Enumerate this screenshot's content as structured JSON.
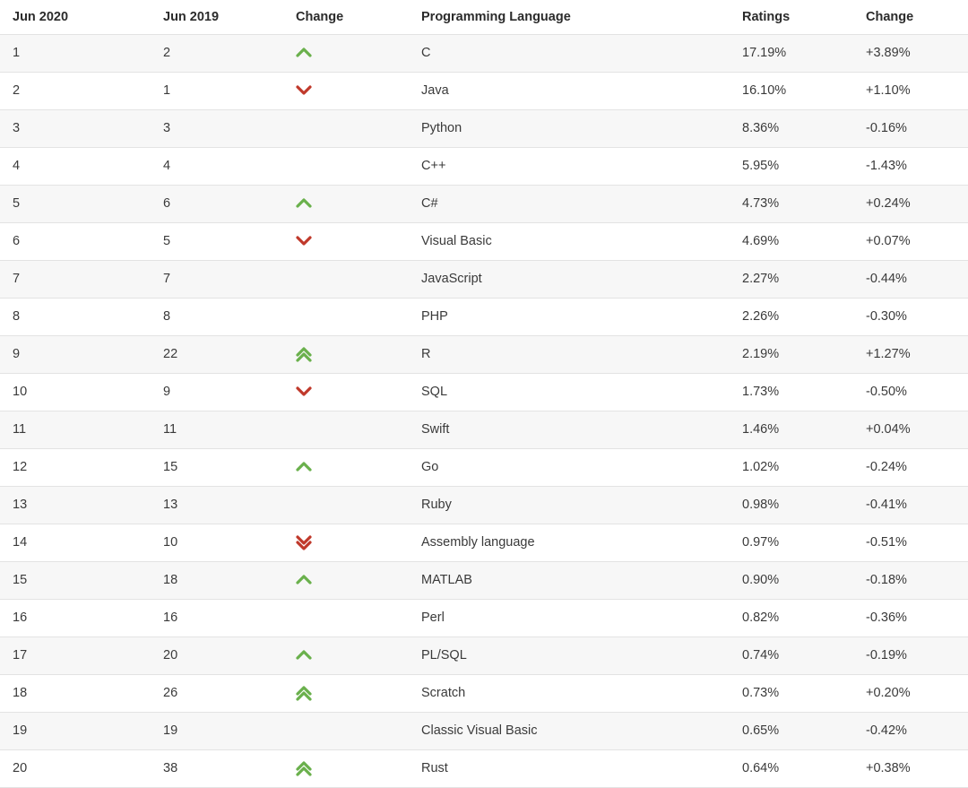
{
  "table": {
    "headers": {
      "rank_current": "Jun 2020",
      "rank_previous": "Jun 2019",
      "change": "Change",
      "language": "Programming Language",
      "ratings": "Ratings",
      "ratings_change": "Change"
    },
    "colors": {
      "up": "#6ab04c",
      "down": "#c0392b",
      "row_alt_bg": "#f7f7f7",
      "row_bg": "#ffffff",
      "border": "#e3e3e3",
      "header_text": "#2b2b2b",
      "body_text": "#3a3a3a"
    },
    "rows": [
      {
        "rank_current": "1",
        "rank_previous": "2",
        "change_icon": "chevron-up-icon",
        "language": "C",
        "ratings": "17.19%",
        "ratings_change": "+3.89%"
      },
      {
        "rank_current": "2",
        "rank_previous": "1",
        "change_icon": "chevron-down-icon",
        "language": "Java",
        "ratings": "16.10%",
        "ratings_change": "+1.10%"
      },
      {
        "rank_current": "3",
        "rank_previous": "3",
        "change_icon": "none",
        "language": "Python",
        "ratings": "8.36%",
        "ratings_change": "-0.16%"
      },
      {
        "rank_current": "4",
        "rank_previous": "4",
        "change_icon": "none",
        "language": "C++",
        "ratings": "5.95%",
        "ratings_change": "-1.43%"
      },
      {
        "rank_current": "5",
        "rank_previous": "6",
        "change_icon": "chevron-up-icon",
        "language": "C#",
        "ratings": "4.73%",
        "ratings_change": "+0.24%"
      },
      {
        "rank_current": "6",
        "rank_previous": "5",
        "change_icon": "chevron-down-icon",
        "language": "Visual Basic",
        "ratings": "4.69%",
        "ratings_change": "+0.07%"
      },
      {
        "rank_current": "7",
        "rank_previous": "7",
        "change_icon": "none",
        "language": "JavaScript",
        "ratings": "2.27%",
        "ratings_change": "-0.44%"
      },
      {
        "rank_current": "8",
        "rank_previous": "8",
        "change_icon": "none",
        "language": "PHP",
        "ratings": "2.26%",
        "ratings_change": "-0.30%"
      },
      {
        "rank_current": "9",
        "rank_previous": "22",
        "change_icon": "double-chevron-up-icon",
        "language": "R",
        "ratings": "2.19%",
        "ratings_change": "+1.27%"
      },
      {
        "rank_current": "10",
        "rank_previous": "9",
        "change_icon": "chevron-down-icon",
        "language": "SQL",
        "ratings": "1.73%",
        "ratings_change": "-0.50%"
      },
      {
        "rank_current": "11",
        "rank_previous": "11",
        "change_icon": "none",
        "language": "Swift",
        "ratings": "1.46%",
        "ratings_change": "+0.04%"
      },
      {
        "rank_current": "12",
        "rank_previous": "15",
        "change_icon": "chevron-up-icon",
        "language": "Go",
        "ratings": "1.02%",
        "ratings_change": "-0.24%"
      },
      {
        "rank_current": "13",
        "rank_previous": "13",
        "change_icon": "none",
        "language": "Ruby",
        "ratings": "0.98%",
        "ratings_change": "-0.41%"
      },
      {
        "rank_current": "14",
        "rank_previous": "10",
        "change_icon": "double-chevron-down-icon",
        "language": "Assembly language",
        "ratings": "0.97%",
        "ratings_change": "-0.51%"
      },
      {
        "rank_current": "15",
        "rank_previous": "18",
        "change_icon": "chevron-up-icon",
        "language": "MATLAB",
        "ratings": "0.90%",
        "ratings_change": "-0.18%"
      },
      {
        "rank_current": "16",
        "rank_previous": "16",
        "change_icon": "none",
        "language": "Perl",
        "ratings": "0.82%",
        "ratings_change": "-0.36%"
      },
      {
        "rank_current": "17",
        "rank_previous": "20",
        "change_icon": "chevron-up-icon",
        "language": "PL/SQL",
        "ratings": "0.74%",
        "ratings_change": "-0.19%"
      },
      {
        "rank_current": "18",
        "rank_previous": "26",
        "change_icon": "double-chevron-up-icon",
        "language": "Scratch",
        "ratings": "0.73%",
        "ratings_change": "+0.20%"
      },
      {
        "rank_current": "19",
        "rank_previous": "19",
        "change_icon": "none",
        "language": "Classic Visual Basic",
        "ratings": "0.65%",
        "ratings_change": "-0.42%"
      },
      {
        "rank_current": "20",
        "rank_previous": "38",
        "change_icon": "double-chevron-up-icon",
        "language": "Rust",
        "ratings": "0.64%",
        "ratings_change": "+0.38%"
      }
    ]
  }
}
